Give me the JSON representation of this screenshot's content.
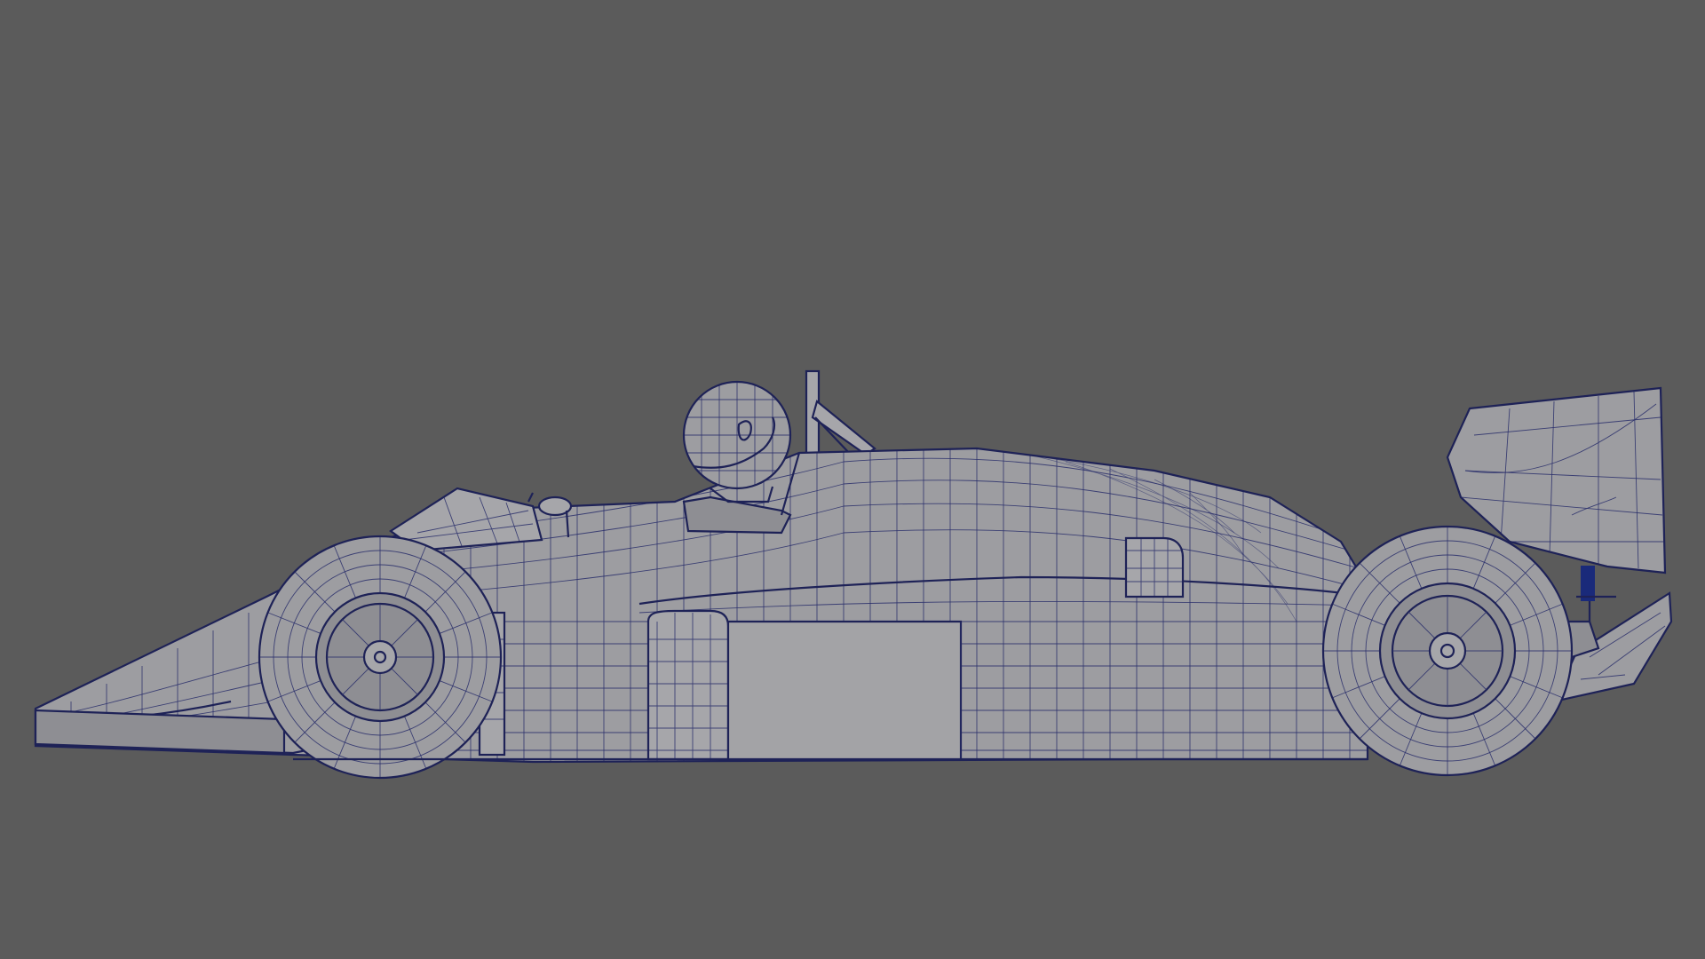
{
  "viewport": {
    "background_color": "#5b5b5b",
    "mesh_fill_color": "#9d9da1",
    "wire_color": "#2a2f6b",
    "edge_color": "#1e2257",
    "accent_block_color": "#1a2a7a",
    "content": "wireframe-race-car-side-view"
  }
}
